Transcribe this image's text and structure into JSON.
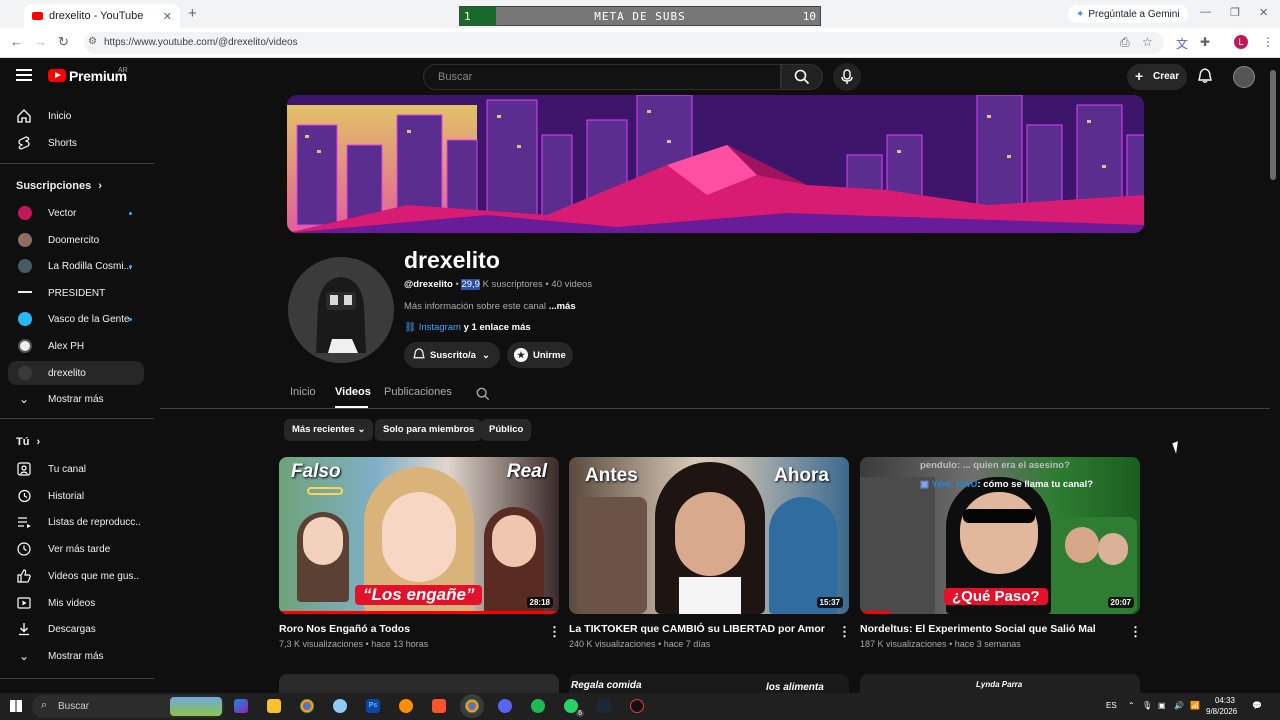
{
  "browser": {
    "tab_title": "drexelito - YouTube",
    "new_tab": "+",
    "url": "https://www.youtube.com/@drexelito/videos",
    "gemini_label": "Pregúntale a Gemini",
    "profile_initial": "L"
  },
  "overlay": {
    "left_value": "1",
    "label": "META DE SUBS",
    "right_value": "10",
    "progress_fraction": 0.1
  },
  "header": {
    "brand": "Premium",
    "country": "AR",
    "search_placeholder": "Buscar",
    "create_label": "Crear"
  },
  "sidebar": {
    "main": [
      {
        "label": "Inicio",
        "icon": "home-icon"
      },
      {
        "label": "Shorts",
        "icon": "shorts-icon"
      }
    ],
    "subs_heading": "Suscripciones",
    "subs": [
      {
        "label": "Vector",
        "dot": true,
        "color": "#c2185b"
      },
      {
        "label": "Doomercito",
        "dot": false,
        "color": "#8d6e63"
      },
      {
        "label": "La Rodilla Cosmi...",
        "dot": true,
        "color": "#455a64"
      },
      {
        "label": "PRESIDENT",
        "dot": false,
        "color": "#111111"
      },
      {
        "label": "Vasco de la Gente",
        "dot": true,
        "color": "#29b6f6"
      },
      {
        "label": "Alex PH",
        "dot": false,
        "color": "#eeeeee"
      },
      {
        "label": "drexelito",
        "dot": false,
        "color": "#3a3a3a"
      }
    ],
    "subs_more": "Mostrar más",
    "you_heading": "Tú",
    "you_items": [
      {
        "label": "Tu canal",
        "icon": "channel-icon"
      },
      {
        "label": "Historial",
        "icon": "history-icon"
      },
      {
        "label": "Listas de reproducc...",
        "icon": "playlists-icon"
      },
      {
        "label": "Ver más tarde",
        "icon": "watch-later-icon"
      },
      {
        "label": "Videos que me gus...",
        "icon": "like-icon"
      },
      {
        "label": "Mis videos",
        "icon": "my-videos-icon"
      },
      {
        "label": "Descargas",
        "icon": "downloads-icon"
      },
      {
        "label": "Mostrar más",
        "icon": "chevron-down-icon"
      }
    ]
  },
  "channel": {
    "name": "drexelito",
    "handle": "@drexelito",
    "sub_count": "29,9",
    "sub_suffix": "K suscriptores",
    "videos_count": "40 videos",
    "description": "Más información sobre este canal",
    "more": "...más",
    "link_label": "Instagram",
    "link_more": "y 1 enlace más",
    "subscribed_label": "Suscrito/a",
    "join_label": "Unirme"
  },
  "tabs": [
    "Inicio",
    "Videos",
    "Publicaciones"
  ],
  "chips": [
    "Más recientes",
    "Solo para miembros",
    "Público"
  ],
  "videos": [
    {
      "title": "Roro Nos Engañó a Todos",
      "views": "7,3 K visualizaciones",
      "age": "hace 13 horas",
      "duration": "28:18",
      "thumb_text_left": "Falso",
      "thumb_text_right": "Real",
      "thumb_caption": "“Los engañe”"
    },
    {
      "title": "La TIKTOKER que CAMBIÓ su LIBERTAD por Amor",
      "views": "240 K visualizaciones",
      "age": "hace 7 días",
      "duration": "15:37",
      "thumb_text_left": "Antes",
      "thumb_text_right": "Ahora"
    },
    {
      "title": "Nordeltus: El Experimento Social que Salió Mal",
      "views": "187 K visualizaciones",
      "age": "hace 3 semanas",
      "duration": "20:07",
      "thumb_chat_1": "pendulo: ... quien era el asesino?",
      "thumb_chat_user": "Yeni_UwU",
      "thumb_chat_2": ": cómo se llama tu canal?",
      "thumb_caption": "¿Qué Paso?"
    }
  ],
  "next_row": {
    "thumb2_left": "Regala comida",
    "thumb2_right": "los alimenta",
    "thumb3": "Lynda Parra"
  },
  "taskbar": {
    "search_label": "Buscar",
    "lang": "ES",
    "time": "04:33",
    "date": "9/8/2026",
    "whatsapp_badge": "6"
  }
}
